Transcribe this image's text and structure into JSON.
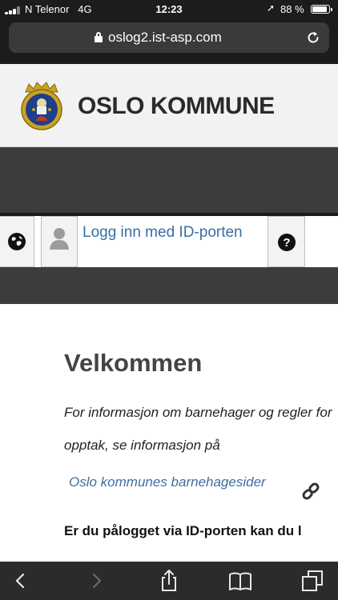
{
  "status": {
    "carrier": "N Telenor",
    "network": "4G",
    "time": "12:23",
    "battery_text": "88 %",
    "battery_level": 0.88
  },
  "browser": {
    "url": "oslog2.ist-asp.com"
  },
  "header": {
    "brand": "OSLO KOMMUNE"
  },
  "toolbar": {
    "login_label": "Logg inn med ID-porten"
  },
  "content": {
    "heading": "Velkommen",
    "intro_line1": "For informasjon om barnehager og regler for",
    "intro_line2": "opptak, se informasjon på",
    "link_text": "Oslo kommunes barnehagesider",
    "bold_text": "Er du pålogget via ID-porten kan du l"
  },
  "colors": {
    "brand_text": "#2a2a2a",
    "nav_band": "#3c3c3c",
    "link": "#3e6f9e"
  },
  "icons": {
    "globe": "globe-icon",
    "user": "user-icon",
    "help": "help-icon",
    "chain": "external-link-icon"
  }
}
